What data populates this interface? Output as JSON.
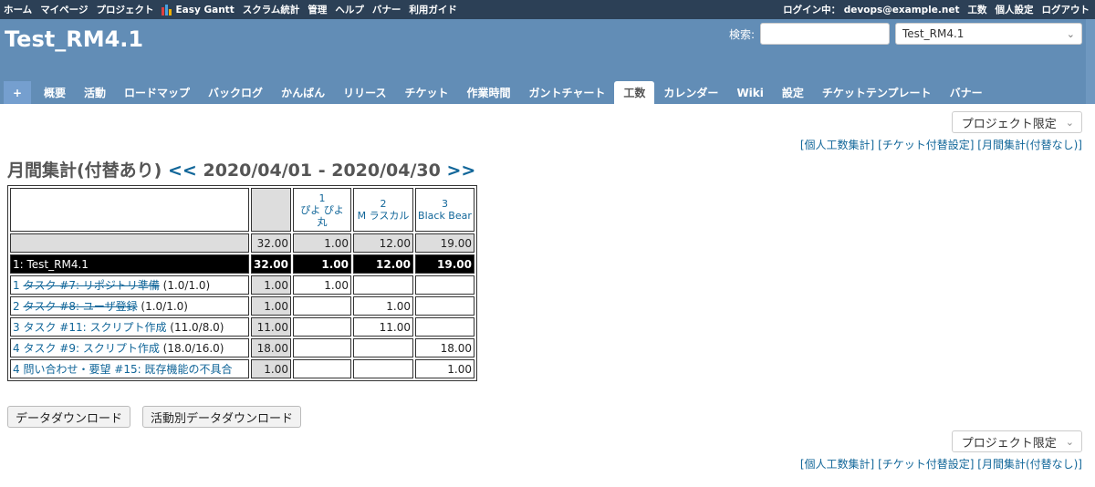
{
  "top_menu": {
    "items": [
      "ホーム",
      "マイページ",
      "プロジェクト"
    ],
    "easy_gantt": "Easy Gantt",
    "items_after": [
      "スクラム統計",
      "管理",
      "ヘルプ",
      "バナー",
      "利用ガイド"
    ],
    "login_label": "ログイン中：",
    "login_user": "devops@example.net",
    "right_items": [
      "工数",
      "個人設定",
      "ログアウト"
    ]
  },
  "header": {
    "project_title": "Test_RM4.1",
    "search_label": "検索:",
    "search_value": "",
    "project_select": "Test_RM4.1"
  },
  "main_menu": {
    "plus": "+",
    "tabs": [
      "概要",
      "活動",
      "ロードマップ",
      "バックログ",
      "かんばん",
      "リリース",
      "チケット",
      "作業時間",
      "ガントチャート",
      "工数",
      "カレンダー",
      "Wiki",
      "設定",
      "チケットテンプレート",
      "バナー"
    ],
    "selected": "工数"
  },
  "filter": {
    "project_limit": "プロジェクト限定"
  },
  "links": [
    "[個人工数集計]",
    "[チケット付替設定]",
    "[月間集計(付替なし)]"
  ],
  "page": {
    "title": "月間集計(付替あり)",
    "prev": "<<",
    "range": "2020/04/01 - 2020/04/30",
    "next": ">>"
  },
  "grid": {
    "users": [
      {
        "num": "1",
        "name": "ぴよ ぴよ丸"
      },
      {
        "num": "2",
        "name": "M ラスカル"
      },
      {
        "num": "3",
        "name": "Black Bear"
      }
    ],
    "total_row": {
      "total": "32.00",
      "values": [
        "1.00",
        "12.00",
        "19.00"
      ]
    },
    "project_row": {
      "label": "1: Test_RM4.1",
      "total": "32.00",
      "values": [
        "1.00",
        "12.00",
        "19.00"
      ]
    },
    "issues": [
      {
        "prefix": "1 ",
        "link": "タスク #7: リポジトリ準備",
        "suffix": " (1.0/1.0)",
        "closed": true,
        "total": "1.00",
        "values": [
          "1.00",
          "",
          ""
        ]
      },
      {
        "prefix": "2 ",
        "link": "タスク #8: ユーザ登録",
        "suffix": " (1.0/1.0)",
        "closed": true,
        "total": "1.00",
        "values": [
          "",
          "1.00",
          ""
        ]
      },
      {
        "prefix": "3 ",
        "link": "タスク #11: スクリプト作成",
        "suffix": " (11.0/8.0)",
        "closed": false,
        "total": "11.00",
        "values": [
          "",
          "11.00",
          ""
        ]
      },
      {
        "prefix": "4 ",
        "link": "タスク #9: スクリプト作成",
        "suffix": " (18.0/16.0)",
        "closed": false,
        "total": "18.00",
        "values": [
          "",
          "",
          "18.00"
        ]
      },
      {
        "prefix": "4 ",
        "link": "問い合わせ・要望 #15: 既存機能の不具合",
        "suffix": "",
        "closed": false,
        "total": "1.00",
        "values": [
          "",
          "",
          "1.00"
        ]
      }
    ]
  },
  "buttons": {
    "download": "データダウンロード",
    "download_by_activity": "活動別データダウンロード"
  },
  "colors": {
    "top_bar": "#2c4056",
    "header": "#628db6",
    "link": "#116699"
  }
}
